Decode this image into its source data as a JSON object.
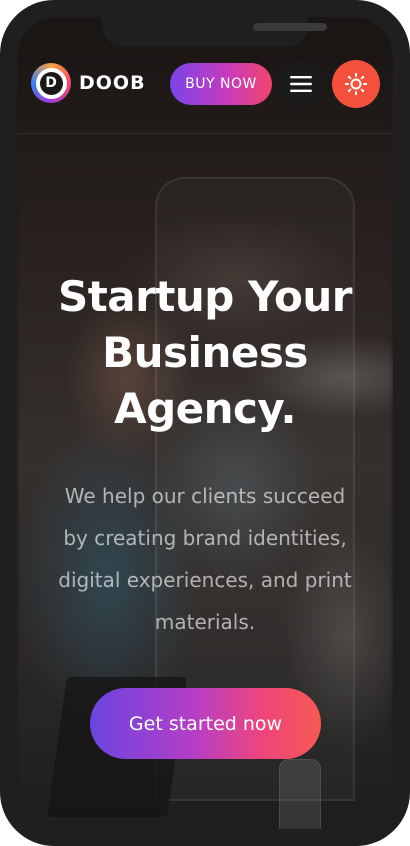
{
  "brand": {
    "logo_letter": "D",
    "name": "DOOB"
  },
  "header": {
    "buy_button": "BUY NOW",
    "menu_icon": "hamburger-menu-icon",
    "theme_icon": "sun-icon"
  },
  "hero": {
    "title_lines": [
      "Startup Your",
      "Business",
      "Agency."
    ],
    "description_lines": [
      "We help our clients succeed",
      "by creating brand identities,",
      "digital experiences, and print",
      "materials."
    ],
    "cta_label": "Get started now"
  },
  "colors": {
    "theme_button": "#f4513d",
    "gradient_start": "#7a45e8",
    "gradient_end": "#f65a52"
  }
}
